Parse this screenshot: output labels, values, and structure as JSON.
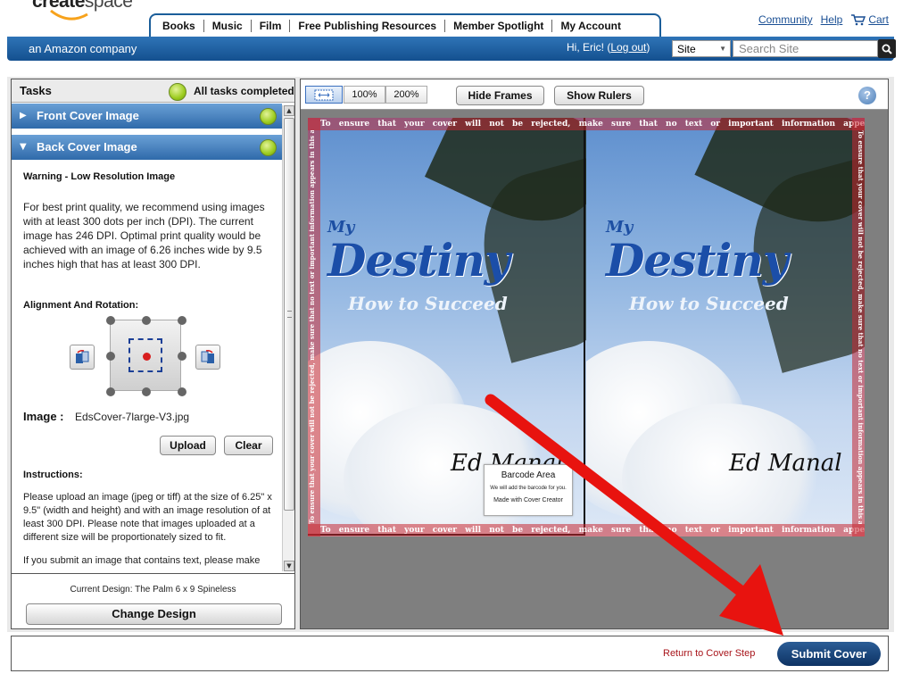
{
  "header": {
    "logo_bold": "create",
    "logo_light": "space",
    "tagline": "an Amazon company",
    "nav_tabs": [
      "Books",
      "Music",
      "Film",
      "Free Publishing Resources",
      "Member Spotlight",
      "My Account"
    ],
    "top_links": {
      "community": "Community",
      "help": "Help",
      "cart": "Cart"
    },
    "greeting": "Hi, Eric! (",
    "logout": "Log out",
    "greeting_end": ")",
    "site_select": "Site",
    "search_placeholder": "Search Site"
  },
  "tasks": {
    "title": "Tasks",
    "status": "All tasks completed",
    "sections": [
      {
        "label": "Front Cover Image",
        "expanded": false
      },
      {
        "label": "Back Cover Image",
        "expanded": true
      }
    ],
    "warning_title": "Warning - Low Resolution Image",
    "warning_text": "For best print quality, we recommend using images with at least 300 dots per inch (DPI). The current image has 246 DPI. Optimal print quality would be achieved with an image of 6.26 inches wide by 9.5 inches high that has at least 300 DPI.",
    "alignment_title": "Alignment And Rotation:",
    "image_label": "Image :",
    "image_name": "EdsCover-7large-V3.jpg",
    "upload_label": "Upload",
    "clear_label": "Clear",
    "instructions_title": "Instructions:",
    "instructions_text": "Please upload an image (jpeg or tiff) at the size of 6.25\" x 9.5\" (width and height) and with an image resolution of at least 300 DPI. Please note that images uploaded at a different size will be proportionately sized to fit.",
    "instructions_text2": "If you submit an image that contains text, please make",
    "current_design": "Current Design: The Palm 6 x 9 Spineless",
    "change_design": "Change Design"
  },
  "toolbar": {
    "zoom_100": "100%",
    "zoom_200": "200%",
    "hide_frames": "Hide Frames",
    "show_rulers": "Show Rulers",
    "help": "?"
  },
  "cover": {
    "title_small": "My",
    "title_big": "Destiny",
    "subtitle": "How to Succeed",
    "author": "Ed Manal",
    "safe_zone_text": "To ensure that your cover will not be rejected, make sure that no text or important information appears in this area.",
    "barcode_title": "Barcode Area",
    "barcode_note": "We will add the barcode for you.",
    "made_with": "Made with Cover Creator"
  },
  "footer": {
    "return_label": "Return to Cover Step",
    "submit_label": "Submit Cover"
  },
  "colors": {
    "brand_blue": "#1b5e9a",
    "submit_blue": "#0e3364",
    "safe_zone": "#c82832",
    "arrow_red": "#e8130f",
    "status_green": "#9ccc1f"
  }
}
